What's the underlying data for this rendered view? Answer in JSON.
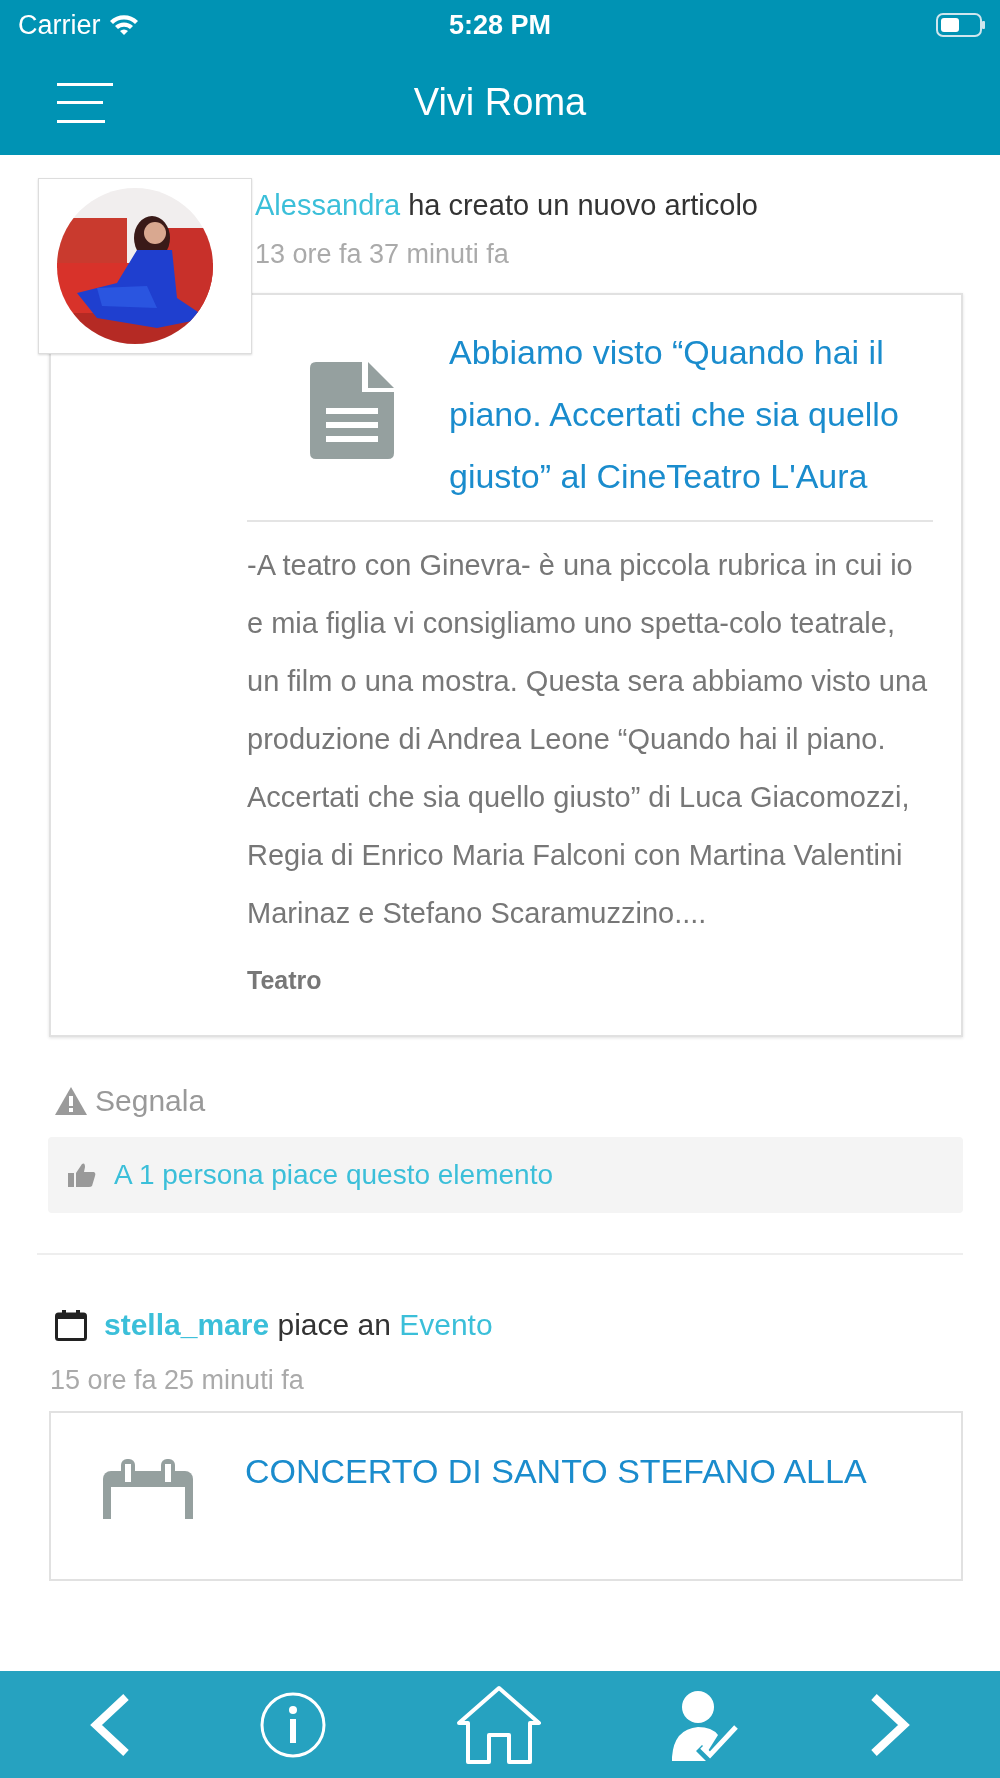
{
  "status_bar": {
    "carrier": "Carrier",
    "time": "5:28 PM"
  },
  "header": {
    "title": "Vivi Roma"
  },
  "feed": [
    {
      "kind": "article",
      "actor": "Alessandra",
      "action": "ha creato un nuovo articolo",
      "time": "13 ore fa 37 minuti fa",
      "card": {
        "title": "Abbiamo visto “Quando hai il piano. Accertati che sia quello giusto” al CineTeatro L'Aura",
        "excerpt": "-A teatro con Ginevra- è una piccola rubrica in cui io e mia figlia vi consigliamo uno spetta-colo teatrale, un film o una mostra. Questa sera abbiamo visto una produzione di Andrea Leone “Quando hai il piano. Accertati che sia quello giusto” di Luca Giacomozzi, Regia di Enrico Maria Falconi con Martina Valentini Marinaz e Stefano Scaramuzzino....",
        "category": "Teatro"
      },
      "report": "Segnala",
      "likes": "A 1 persona piace questo elemento"
    },
    {
      "kind": "event",
      "actor": "stella_mare",
      "action": "piace an",
      "object": "Evento",
      "time": "15 ore fa 25 minuti fa",
      "card": {
        "title": "CONCERTO DI SANTO STEFANO ALLA"
      }
    }
  ],
  "bottom_nav": [
    {
      "kind": "back"
    },
    {
      "kind": "info"
    },
    {
      "kind": "home"
    },
    {
      "kind": "user"
    },
    {
      "kind": "forward"
    }
  ]
}
